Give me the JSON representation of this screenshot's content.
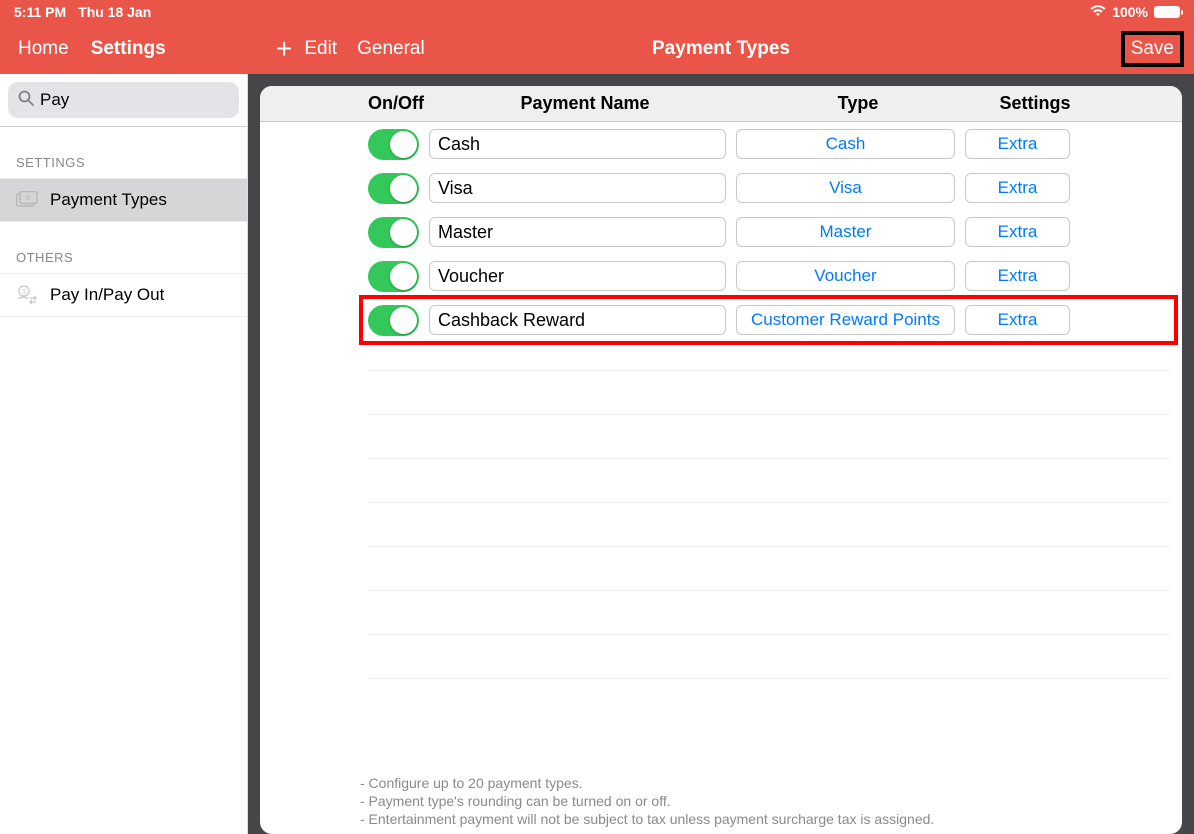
{
  "status": {
    "time": "5:11 PM",
    "date": "Thu 18 Jan",
    "battery": "100%"
  },
  "topbar_left": {
    "home": "Home",
    "settings": "Settings"
  },
  "topbar_right": {
    "edit": "Edit",
    "general": "General",
    "title": "Payment Types",
    "save": "Save"
  },
  "search": {
    "value": "Pay"
  },
  "sections": {
    "settings": "SETTINGS",
    "others": "OTHERS"
  },
  "sidebar": {
    "item_payment_types": "Payment Types",
    "item_pay_in_out": "Pay In/Pay Out"
  },
  "thead": {
    "onoff": "On/Off",
    "name": "Payment Name",
    "type": "Type",
    "settings": "Settings"
  },
  "rows": [
    {
      "name": "Cash",
      "type": "Cash",
      "settings": "Extra",
      "highlight": false
    },
    {
      "name": "Visa",
      "type": "Visa",
      "settings": "Extra",
      "highlight": false
    },
    {
      "name": "Master",
      "type": "Master",
      "settings": "Extra",
      "highlight": false
    },
    {
      "name": "Voucher",
      "type": "Voucher",
      "settings": "Extra",
      "highlight": false
    },
    {
      "name": "Cashback Reward",
      "type": "Customer Reward Points",
      "settings": "Extra",
      "highlight": true
    }
  ],
  "footer": {
    "l1": "- Configure up to 20 payment types.",
    "l2": "- Payment type's rounding can be turned on or off.",
    "l3": "- Entertainment payment will not be subject to tax unless payment surcharge tax is assigned."
  }
}
